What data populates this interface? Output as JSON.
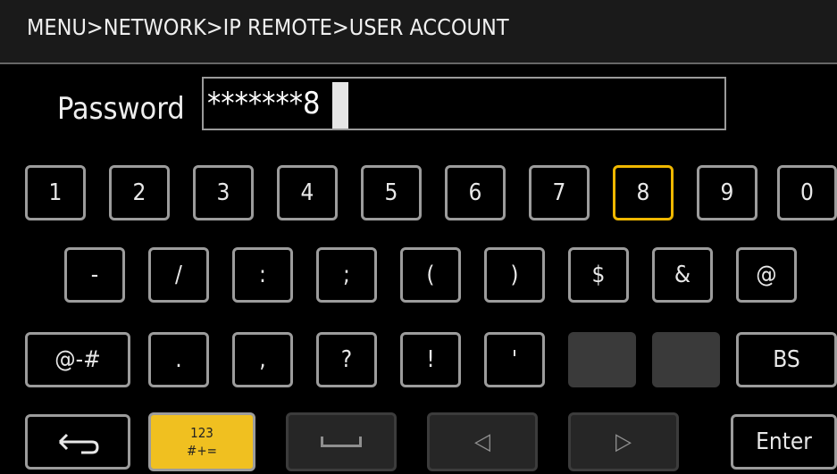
{
  "header": {
    "breadcrumb": "MENU>NETWORK>IP REMOTE>USER ACCOUNT"
  },
  "password": {
    "label": "Password",
    "value": "*******8"
  },
  "rows": {
    "r1": [
      "1",
      "2",
      "3",
      "4",
      "5",
      "6",
      "7",
      "8",
      "9",
      "0"
    ],
    "r2": [
      "-",
      "/",
      ":",
      ";",
      "(",
      ")",
      "$",
      "&",
      "@"
    ],
    "r3": [
      "@-#",
      ".",
      ",",
      "?",
      "!",
      "'",
      "",
      "",
      "BS"
    ]
  },
  "bottom": {
    "mode_top": "123",
    "mode_bottom": "#+=",
    "left_arrow": "◁",
    "right_arrow": "▷",
    "enter": "Enter"
  },
  "selected_key": "8",
  "colors": {
    "selection": "#f0b800",
    "mode_key": "#f0c020",
    "border": "#9c9c9c"
  },
  "icons": {
    "back": "return-arrow-icon",
    "space": "space-bar-icon"
  }
}
